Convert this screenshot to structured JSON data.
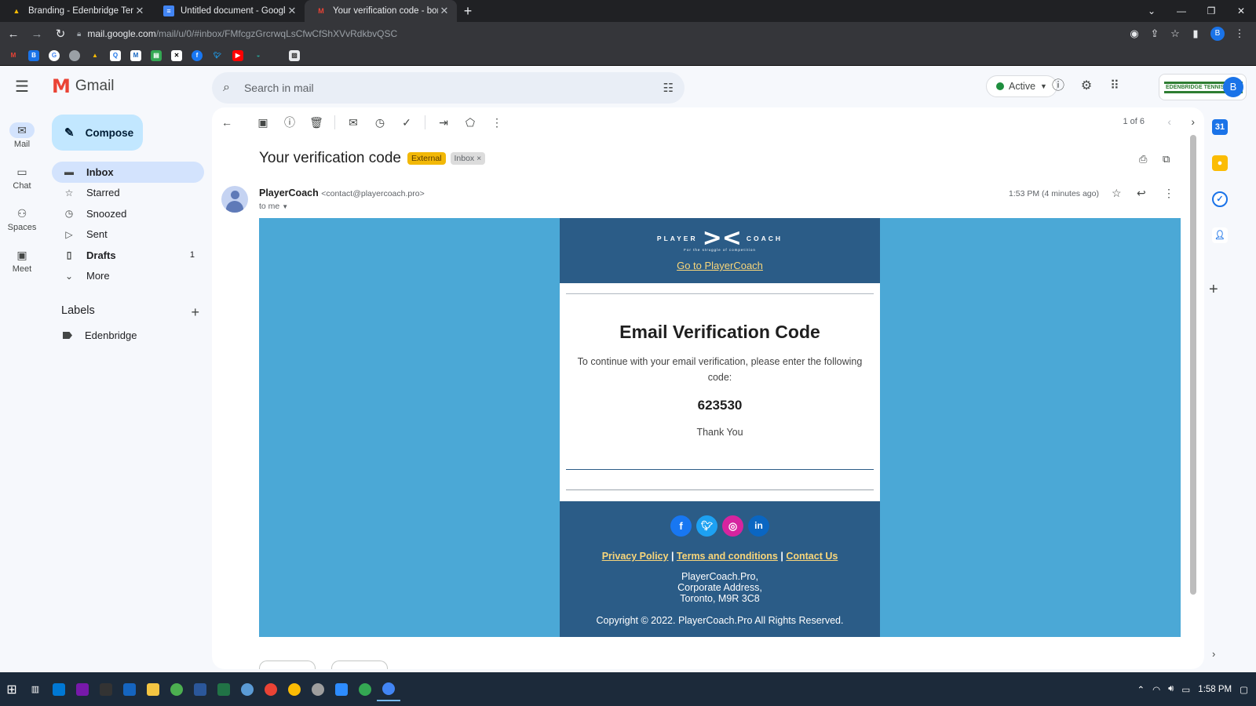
{
  "browser": {
    "tabs": [
      {
        "title": "Branding - Edenbridge Tennis Cl",
        "icon": "drive-icon",
        "active": false
      },
      {
        "title": "Untitled document - Google Doc",
        "icon": "docs-icon",
        "active": false
      },
      {
        "title": "Your verification code - boris@e",
        "icon": "gmail-icon",
        "active": true
      }
    ],
    "url_host": "mail.google.com",
    "url_path": "/mail/u/0/#inbox/FMfcgzGrcrwqLsCfwCfShXVvRdkbvQSC",
    "profile_initial": "B",
    "bookmarks": [
      "gmail",
      "b",
      "google",
      "circle",
      "drive",
      "q",
      "m",
      "sheet",
      "x",
      "facebook",
      "twitter",
      "youtube",
      "shell",
      "picture"
    ]
  },
  "gmail": {
    "product_name": "Gmail",
    "search_placeholder": "Search in mail",
    "status": "Active",
    "club_logo_text": "EDENBRIDGE TENNIS CLUB",
    "account_initial": "B",
    "rail": [
      {
        "label": "Mail",
        "icon": "mail-icon"
      },
      {
        "label": "Chat",
        "icon": "chat-icon"
      },
      {
        "label": "Spaces",
        "icon": "spaces-icon"
      },
      {
        "label": "Meet",
        "icon": "meet-icon"
      }
    ],
    "compose_label": "Compose",
    "nav": [
      {
        "label": "Inbox",
        "icon": "inbox-icon",
        "count": ""
      },
      {
        "label": "Starred",
        "icon": "star-icon",
        "count": ""
      },
      {
        "label": "Snoozed",
        "icon": "clock-icon",
        "count": ""
      },
      {
        "label": "Sent",
        "icon": "send-icon",
        "count": ""
      },
      {
        "label": "Drafts",
        "icon": "draft-icon",
        "count": "1"
      },
      {
        "label": "More",
        "icon": "chevron-down-icon",
        "count": ""
      }
    ],
    "labels_heading": "Labels",
    "labels": [
      "Edenbridge"
    ],
    "pager": "1 of 6"
  },
  "message": {
    "subject": "Your verification code",
    "chip_external": "External",
    "chip_inbox": "Inbox",
    "sender_name": "PlayerCoach",
    "sender_email": "<contact@playercoach.pro>",
    "to_line": "to me",
    "time": "1:53 PM (4 minutes ago)"
  },
  "email": {
    "logo_left": "PLAYER",
    "logo_right": "COACH",
    "logo_tagline": "For the struggle of competition",
    "go_link": "Go to PlayerCoach",
    "title": "Email Verification Code",
    "description": "To continue with your email verification, please enter the following code:",
    "code": "623530",
    "thanks": "Thank You",
    "footer_links": [
      "Privacy Policy",
      "Terms and conditions",
      "Contact Us"
    ],
    "address_lines": [
      "PlayerCoach.Pro,",
      "Corporate Address,",
      "Toronto, M9R 3C8"
    ],
    "copyright": "Copyright © 2022. PlayerCoach.Pro All Rights Reserved."
  },
  "taskbar": {
    "time": "1:58 PM"
  }
}
